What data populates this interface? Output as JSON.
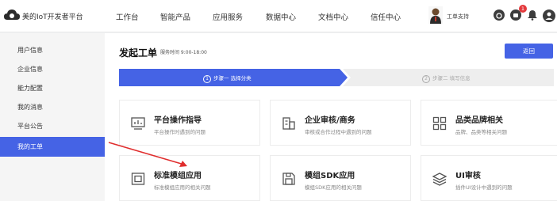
{
  "header": {
    "brand": "美的IoT开发者平台",
    "nav": [
      "工作台",
      "智能产品",
      "应用服务",
      "数据中心",
      "文档中心",
      "信任中心"
    ],
    "user_label": "工单支持",
    "notification_count": "1"
  },
  "sidebar": {
    "items": [
      {
        "label": "用户信息"
      },
      {
        "label": "企业信息"
      },
      {
        "label": "能力配置"
      },
      {
        "label": "我的消息"
      },
      {
        "label": "平台公告"
      },
      {
        "label": "我的工单"
      }
    ],
    "active_index": 5
  },
  "main": {
    "title": "发起工单",
    "service_time": "服务时间 9:00-18:00",
    "back_label": "返回",
    "steps": [
      {
        "num": "1",
        "label": "步骤一 选择分类"
      },
      {
        "num": "2",
        "label": "步骤二 填写信息"
      }
    ],
    "cards": [
      {
        "title": "平台操作指导",
        "desc": "平台操作时遇到的问题",
        "icon": "monitor-chart-icon"
      },
      {
        "title": "企业审核/商务",
        "desc": "审核或合作过程中遇到的问题",
        "icon": "enterprise-icon"
      },
      {
        "title": "品类品牌相关",
        "desc": "品牌、品类等相关问题",
        "icon": "grid-icon"
      },
      {
        "title": "标准模组应用",
        "desc": "标准模组应用的相关问题",
        "icon": "module-icon"
      },
      {
        "title": "模组SDK应用",
        "desc": "模组SDK应用的相关问题",
        "icon": "sdk-icon"
      },
      {
        "title": "UI审核",
        "desc": "插件UI设计中遇到的问题",
        "icon": "layers-icon"
      }
    ]
  },
  "colors": {
    "accent": "#4563e5",
    "step_active": "#4563e5",
    "step_inactive": "#eeeeee",
    "arrow": "#e02d2d"
  }
}
